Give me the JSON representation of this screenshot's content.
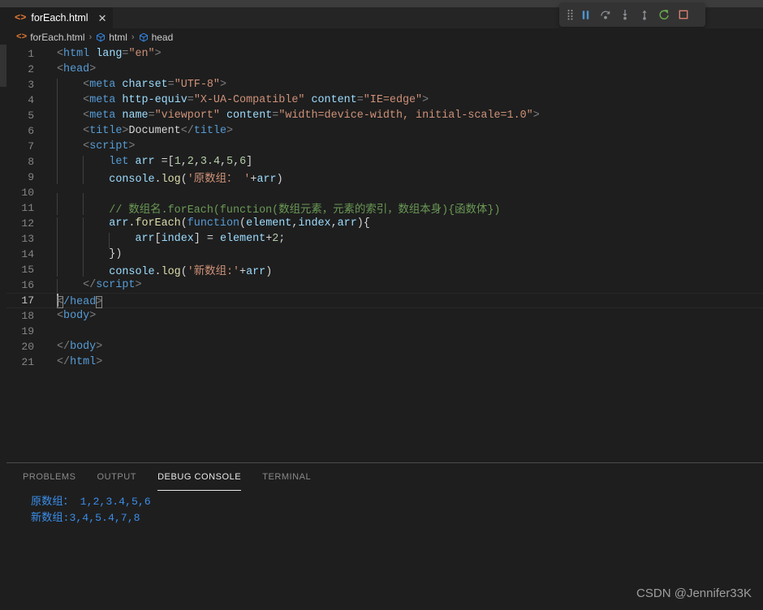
{
  "tab": {
    "label": "forEach.html",
    "icon": "html-file-icon",
    "close_label": "✕"
  },
  "debug_toolbar": {
    "buttons": [
      {
        "name": "drag-handle",
        "title": "Drag"
      },
      {
        "name": "pause-button",
        "title": "Pause"
      },
      {
        "name": "step-over-button",
        "title": "Step Over"
      },
      {
        "name": "step-into-button",
        "title": "Step Into"
      },
      {
        "name": "step-out-button",
        "title": "Step Out"
      },
      {
        "name": "restart-button",
        "title": "Restart"
      },
      {
        "name": "stop-button",
        "title": "Stop"
      }
    ],
    "colors": {
      "pause": "#4e94ce",
      "step": "#8b8f93",
      "restart": "#6aa84f",
      "stop": "#d88070",
      "background": "#333333"
    }
  },
  "breadcrumb": {
    "items": [
      {
        "label": "forEach.html",
        "icon": "html-file-icon"
      },
      {
        "label": "html",
        "icon": "symbol-cube-icon"
      },
      {
        "label": "head",
        "icon": "symbol-cube-icon"
      }
    ],
    "separator": "›"
  },
  "editor": {
    "current_line": 17,
    "lines": [
      {
        "n": 1,
        "indent": 0
      },
      {
        "n": 2,
        "indent": 0
      },
      {
        "n": 3,
        "indent": 1
      },
      {
        "n": 4,
        "indent": 1
      },
      {
        "n": 5,
        "indent": 1
      },
      {
        "n": 6,
        "indent": 1
      },
      {
        "n": 7,
        "indent": 1
      },
      {
        "n": 8,
        "indent": 2
      },
      {
        "n": 9,
        "indent": 2
      },
      {
        "n": 10,
        "indent": 2
      },
      {
        "n": 11,
        "indent": 2
      },
      {
        "n": 12,
        "indent": 2
      },
      {
        "n": 13,
        "indent": 3
      },
      {
        "n": 14,
        "indent": 2
      },
      {
        "n": 15,
        "indent": 2
      },
      {
        "n": 16,
        "indent": 1
      },
      {
        "n": 17,
        "indent": 0
      },
      {
        "n": 18,
        "indent": 0
      },
      {
        "n": 19,
        "indent": 0
      },
      {
        "n": 20,
        "indent": 0
      },
      {
        "n": 21,
        "indent": 0
      }
    ],
    "code": {
      "l1_lt": "<",
      "l1_tag": "html",
      "l1_sp": " ",
      "l1_attr": "lang",
      "l1_eq": "=",
      "l1_val": "\"en\"",
      "l1_gt": ">",
      "l2_lt": "<",
      "l2_tag": "head",
      "l2_gt": ">",
      "l3_lt": "<",
      "l3_tag": "meta",
      "l3_sp": " ",
      "l3_attr": "charset",
      "l3_eq": "=",
      "l3_val": "\"UTF-8\"",
      "l3_gt": ">",
      "l4_lt": "<",
      "l4_tag": "meta",
      "l4_sp": " ",
      "l4_attr": "http-equiv",
      "l4_eq": "=",
      "l4_val": "\"X-UA-Compatible\"",
      "l4_sp2": " ",
      "l4_attr2": "content",
      "l4_eq2": "=",
      "l4_val2": "\"IE=edge\"",
      "l4_gt": ">",
      "l5_lt": "<",
      "l5_tag": "meta",
      "l5_sp": " ",
      "l5_attr": "name",
      "l5_eq": "=",
      "l5_val": "\"viewport\"",
      "l5_sp2": " ",
      "l5_attr2": "content",
      "l5_eq2": "=",
      "l5_val2": "\"width=device-width, initial-scale=1.0\"",
      "l5_gt": ">",
      "l6_lt": "<",
      "l6_tag": "title",
      "l6_gt": ">",
      "l6_text": "Document",
      "l6_ltc": "</",
      "l6_tagc": "title",
      "l6_gtc": ">",
      "l7_lt": "<",
      "l7_tag": "script",
      "l7_gt": ">",
      "l8_kw": "let",
      "l8_sp": " ",
      "l8_var": "arr",
      "l8_eq": " =",
      "l8_br1": "[",
      "l8_n1": "1",
      "l8_c1": ",",
      "l8_n2": "2",
      "l8_c2": ",",
      "l8_n3": "3.4",
      "l8_c3": ",",
      "l8_n4": "5",
      "l8_c4": ",",
      "l8_n5": "6",
      "l8_br2": "]",
      "l9_obj": "console",
      "l9_dot": ".",
      "l9_fn": "log",
      "l9_p1": "(",
      "l9_str": "'原数组： '",
      "l9_plus": "+",
      "l9_var": "arr",
      "l9_p2": ")",
      "l11_cmt": "// 数组名.forEach(function(数组元素，元素的索引，数组本身){函数体})",
      "l12_obj": "arr",
      "l12_dot": ".",
      "l12_fn": "forEach",
      "l12_p1": "(",
      "l12_kw": "function",
      "l12_p2": "(",
      "l12_a1": "element",
      "l12_c1": ",",
      "l12_a2": "index",
      "l12_c2": ",",
      "l12_a3": "arr",
      "l12_p3": ")",
      "l12_brace": "{",
      "l13_var": "arr",
      "l13_br1": "[",
      "l13_idx": "index",
      "l13_br2": "]",
      "l13_eq": " = ",
      "l13_el": "element",
      "l13_plus": "+",
      "l13_num": "2",
      "l13_semi": ";",
      "l14_close": "})",
      "l15_obj": "console",
      "l15_dot": ".",
      "l15_fn": "log",
      "l15_p1": "(",
      "l15_str": "'新数组:'",
      "l15_plus": "+",
      "l15_var": "arr",
      "l15_p2": ")",
      "l16_ltc": "</",
      "l16_tagc": "script",
      "l16_gtc": ">",
      "l17_lt": "<",
      "l17_slash": "/head",
      "l17_gt": ">",
      "l18_lt": "<",
      "l18_tag": "body",
      "l18_gt": ">",
      "l20_ltc": "</",
      "l20_tagc": "body",
      "l20_gtc": ">",
      "l21_ltc": "</",
      "l21_tagc": "html",
      "l21_gtc": ">"
    }
  },
  "panel": {
    "tabs": [
      {
        "label": "PROBLEMS",
        "active": false
      },
      {
        "label": "OUTPUT",
        "active": false
      },
      {
        "label": "DEBUG CONSOLE",
        "active": true
      },
      {
        "label": "TERMINAL",
        "active": false
      }
    ],
    "console_output": [
      "原数组： 1,2,3.4,5,6",
      "新数组:3,4,5.4,7,8"
    ],
    "output_color": "#3b8eea"
  },
  "watermark": {
    "text": "CSDN @Jennifer33K"
  },
  "theme": {
    "editor_bg": "#1e1e1e",
    "tabbar_bg": "#252526",
    "accent_tag": "#569cd6",
    "accent_string": "#ce9178",
    "accent_comment": "#6a9955",
    "accent_number": "#b5cea8",
    "accent_function": "#dcdcaa",
    "accent_variable": "#9cdcfe"
  }
}
